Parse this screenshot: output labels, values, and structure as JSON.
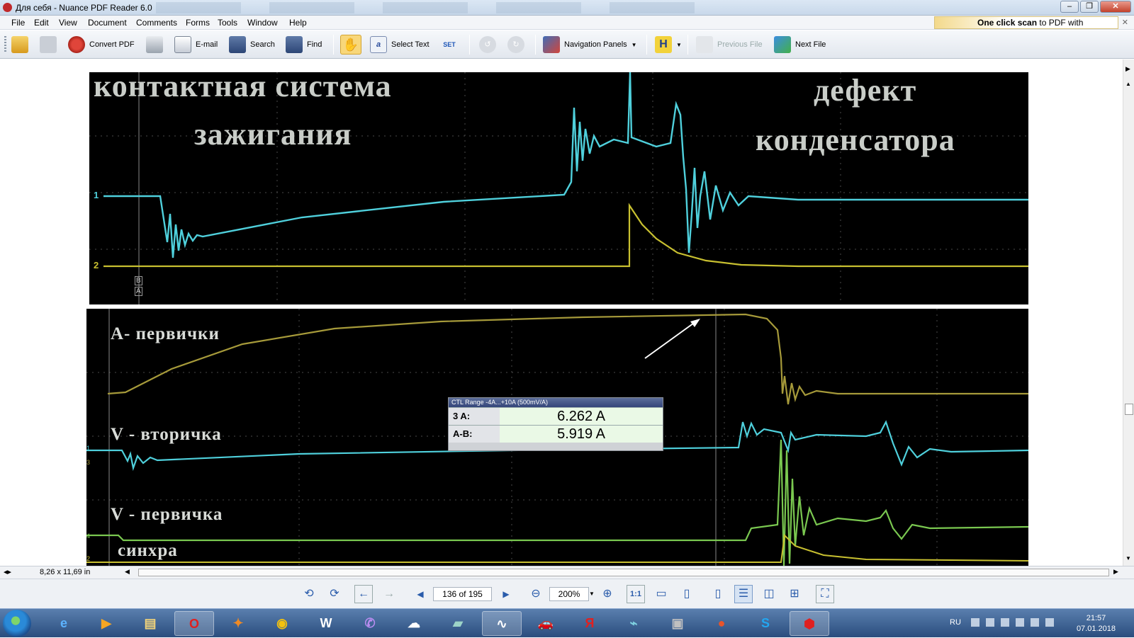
{
  "window": {
    "title": "Для себя - Nuance PDF Reader 6.0"
  },
  "menu": [
    "File",
    "Edit",
    "View",
    "Document",
    "Comments",
    "Forms",
    "Tools",
    "Window",
    "Help"
  ],
  "promo": {
    "bold": "One click scan",
    "rest": " to PDF with"
  },
  "toolbar": {
    "convert": "Convert PDF",
    "email": "E-mail",
    "search": "Search",
    "find": "Find",
    "select_text": "Select Text",
    "nav_panels": "Navigation Panels",
    "previous_file": "Previous File",
    "next_file": "Next File",
    "set": "SET"
  },
  "page": {
    "top_title_left_1": "контактная система",
    "top_title_left_2": "зажигания",
    "top_title_right_1": "дефект",
    "top_title_right_2": "конденсатора",
    "ch1": "1",
    "ch2": "2",
    "cursor_mark_b": "B",
    "cursor_mark_a": "A",
    "bottom_label_1": "А- первички",
    "bottom_label_2": "V - вторичка",
    "bottom_label_3": "V - первичка",
    "bottom_label_4": "синхра",
    "ch_low_1": "1",
    "ch_low_3": "3",
    "ch_low_4": "4",
    "ch_low_2": "2",
    "cursor_header": "CTL Range -4A...+10A (500mV/A)",
    "cursor_rows": [
      {
        "key": "3  A:",
        "value": "6.262 A"
      },
      {
        "key": "A-B:",
        "value": "5.919 A"
      }
    ]
  },
  "status": {
    "page_size": "8,26 x 11,69 in"
  },
  "nav": {
    "page": "136 of 195",
    "zoom": "200%"
  },
  "taskbar": {
    "lang": "RU",
    "time": "21:57",
    "date": "07.01.2018"
  },
  "colors": {
    "scope_cyan": "#4fd0dc",
    "scope_yellow": "#c8c030",
    "scope_green": "#7ac850",
    "scope_olive": "#a69a3a",
    "scope_grid": "#505050"
  }
}
